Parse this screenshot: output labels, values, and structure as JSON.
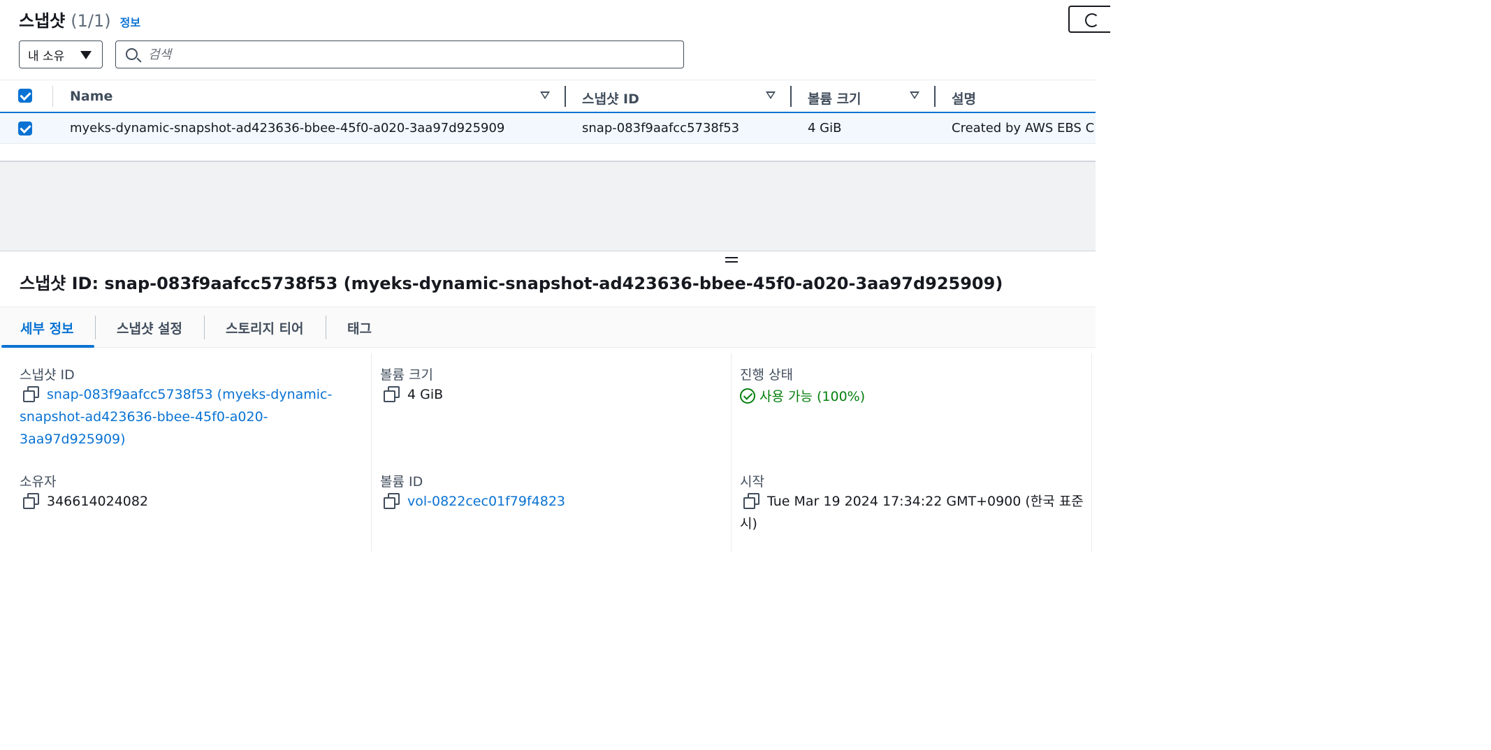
{
  "header": {
    "title": "스냅샷",
    "count": "(1/1)",
    "info_link": "정보"
  },
  "filter": {
    "owner_selected": "내 소유",
    "search_placeholder": "검색"
  },
  "table": {
    "columns": [
      "Name",
      "스냅샷 ID",
      "볼륨 크기",
      "설명"
    ],
    "rows": [
      {
        "selected": true,
        "name": "myeks-dynamic-snapshot-ad423636-bbee-45f0-a020-3aa97d925909",
        "snapshot_id": "snap-083f9aafcc5738f53",
        "volume_size": "4 GiB",
        "description": "Created by AWS EBS C"
      }
    ]
  },
  "detail": {
    "title": "스냅샷 ID: snap-083f9aafcc5738f53 (myeks-dynamic-snapshot-ad423636-bbee-45f0-a020-3aa97d925909)",
    "tabs": [
      "세부 정보",
      "스냅샷 설정",
      "스토리지 티어",
      "태그"
    ],
    "active_tab": "세부 정보",
    "fields": {
      "snapshot_id_label": "스냅샷 ID",
      "snapshot_id_line1": "snap-083f9aafcc5738f53 (myeks-dynamic-",
      "snapshot_id_line2": "snapshot-ad423636-bbee-45f0-a020-",
      "snapshot_id_line3": "3aa97d925909)",
      "volume_size_label": "볼륨 크기",
      "volume_size_value": "4 GiB",
      "progress_label": "진행 상태",
      "progress_value": "사용 가능 (100%)",
      "owner_label": "소유자",
      "owner_value": "346614024082",
      "volume_id_label": "볼륨 ID",
      "volume_id_value": "vol-0822cec01f79f4823",
      "started_label": "시작",
      "started_line1": "Tue Mar 19 2024 17:34:22 GMT+0900 (한국 표준",
      "started_line2": "시)"
    }
  },
  "colors": {
    "link": "#0972d3",
    "success": "#037f0c",
    "text": "#16191f"
  },
  "icons": [
    "search-icon",
    "caret-down-icon",
    "sort-icon",
    "copy-icon",
    "success-icon",
    "refresh-icon",
    "resize-handle-icon"
  ]
}
